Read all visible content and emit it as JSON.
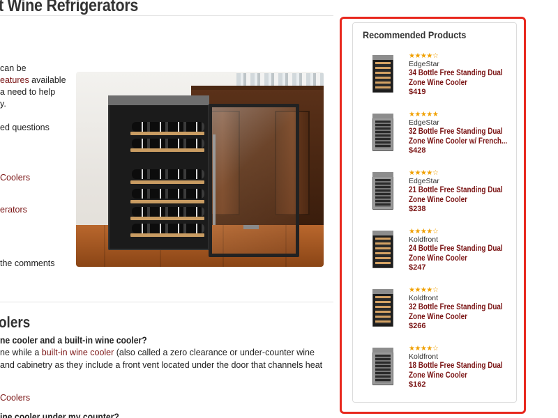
{
  "article": {
    "title": "t Wine Refrigerators",
    "intro_lines": [
      {
        "parts": [
          {
            "t": "can be",
            "link": false
          }
        ]
      },
      {
        "parts": [
          {
            "t": "eatures",
            "link": true
          },
          {
            "t": " available",
            "link": false
          }
        ]
      },
      {
        "parts": [
          {
            "t": "a need to help",
            "link": false
          }
        ]
      },
      {
        "parts": [
          {
            "t": "y.",
            "link": false
          }
        ]
      },
      {
        "parts": [
          {
            "t": "",
            "link": false
          }
        ]
      },
      {
        "parts": [
          {
            "t": "ed questions",
            "link": false
          }
        ]
      }
    ],
    "toc_links": [
      "Coolers",
      "erators"
    ],
    "comments_text": "the comments",
    "section_heading": "olers",
    "faq": [
      {
        "question": "ne cooler and a built-in wine cooler?",
        "answer_lines": [
          [
            {
              "t": "ne while a ",
              "link": false
            },
            {
              "t": "built-in wine cooler",
              "link": true
            },
            {
              "t": " (also called a zero clearance or under-counter wine",
              "link": false
            }
          ],
          [
            {
              "t": " and cabinetry as they include a front vent located under the door that channels heat",
              "link": false
            }
          ]
        ],
        "link_after": "Coolers"
      },
      {
        "question": "ine cooler under my counter?"
      }
    ]
  },
  "recommended": {
    "title": "Recommended Products",
    "items": [
      {
        "stars": "★★★★☆",
        "rating": 4,
        "brand": "EdgeStar",
        "name_lines": [
          "34 Bottle Free Standing Dual",
          "Zone Wine Cooler"
        ],
        "price": "$419",
        "thumb": "dual"
      },
      {
        "stars": "★★★★★",
        "rating": 5,
        "brand": "EdgeStar",
        "name_lines": [
          "32 Bottle Free Standing Dual",
          "Zone Wine Cooler w/ French..."
        ],
        "price": "$428",
        "thumb": "steel"
      },
      {
        "stars": "★★★★☆",
        "rating": 4,
        "brand": "EdgeStar",
        "name_lines": [
          "21 Bottle Free Standing Dual",
          "Zone Wine Cooler"
        ],
        "price": "$238",
        "thumb": "steel"
      },
      {
        "stars": "★★★★☆",
        "rating": 4,
        "brand": "Koldfront",
        "name_lines": [
          "24 Bottle Free Standing Dual",
          "Zone Wine Cooler"
        ],
        "price": "$247",
        "thumb": "dual"
      },
      {
        "stars": "★★★★☆",
        "rating": 4,
        "brand": "Koldfront",
        "name_lines": [
          "32 Bottle Free Standing Dual",
          "Zone Wine Cooler"
        ],
        "price": "$266",
        "thumb": "dual"
      },
      {
        "stars": "★★★★☆",
        "rating": 4,
        "brand": "Koldfront",
        "name_lines": [
          "18 Bottle Free Standing Dual",
          "Zone Wine Cooler"
        ],
        "price": "$162",
        "thumb": "steel"
      }
    ]
  },
  "colors": {
    "link": "#7a1414",
    "star": "#f0a000",
    "highlight_frame": "#e8281e"
  }
}
